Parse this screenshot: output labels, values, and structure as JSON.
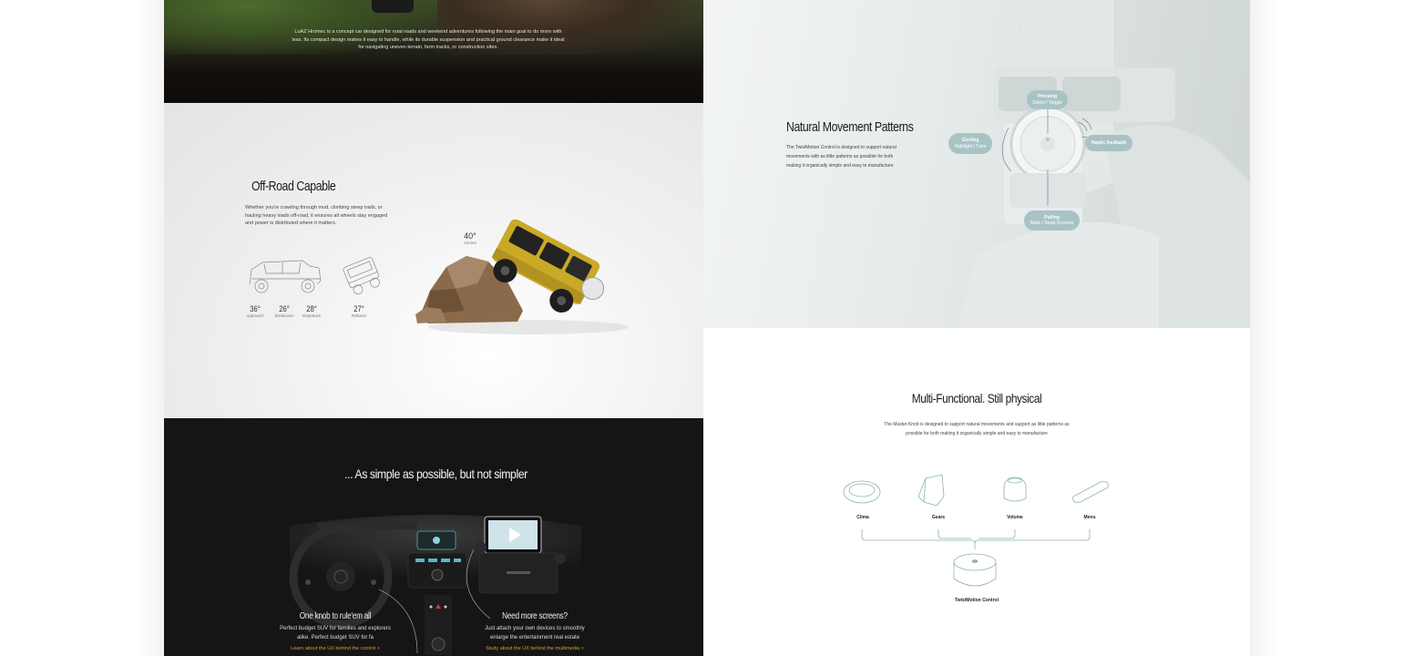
{
  "hero": {
    "description": "LuAZ Hromec is a concept car designed for rural roads and weekend adventures following the main goal to do more with less. Its compact design makes it easy to handle, while its durable suspension and practical ground clearance make it ideal for navigating uneven terrain, farm tracks, or construction sites."
  },
  "offroad": {
    "title": "Off-Road Capable",
    "description": "Whether you're crawling through mud, climbing steep trails, or hauling heavy loads off-road, it ensures all wheels stay engaged and power is distributed where it matters.",
    "angles": [
      {
        "value": "36°",
        "label": "Approach"
      },
      {
        "value": "26°",
        "label": "Breakover"
      },
      {
        "value": "28°",
        "label": "Departure"
      },
      {
        "value": "27°",
        "label": "Rollover"
      }
    ],
    "ascent": {
      "value": "40°",
      "label": "Ascent"
    }
  },
  "dash": {
    "title": "... As simple as possible, but not simpler",
    "left": {
      "title": "One knob to rule'em all",
      "description": "Perfect budget SUV for families and explorers alike. Perfect budget SUV for fa",
      "link": "Learn about the UX behind the control >"
    },
    "right": {
      "title": "Need more screens?",
      "description": "Just attach your own devices to smoothly enlarge the entertainment real estate",
      "link": "Study about the UX behind the multimedia >"
    }
  },
  "natural": {
    "title": "Natural Movement Patterns",
    "description": "The TwistMotion Control is designed to support natural movements with as little patterns as possible for both making it organically simple and easy to manufacture",
    "gestures": [
      {
        "name": "Pressing",
        "action": "Select / Toggle"
      },
      {
        "name": "Circling",
        "action": "Highlight / Tune"
      },
      {
        "name": "Haptic feedback",
        "action": ""
      },
      {
        "name": "Pulling",
        "action": "Back / Swap Screens"
      }
    ]
  },
  "multi": {
    "title": "Multi-Functional. Still physical",
    "description": "The Master Knob is designed to support natural movements and support as little patterns as possible for both making it organically simple and easy to manufacture",
    "modules": [
      "Clima",
      "Gears",
      "Volume",
      "Menu"
    ],
    "control": "TwistMotion Control"
  },
  "colors": {
    "accent_link": "#d6a21e",
    "pill": "#a9c3c5",
    "dark_bg": "#151515",
    "line_teal": "#8fb1b4"
  }
}
